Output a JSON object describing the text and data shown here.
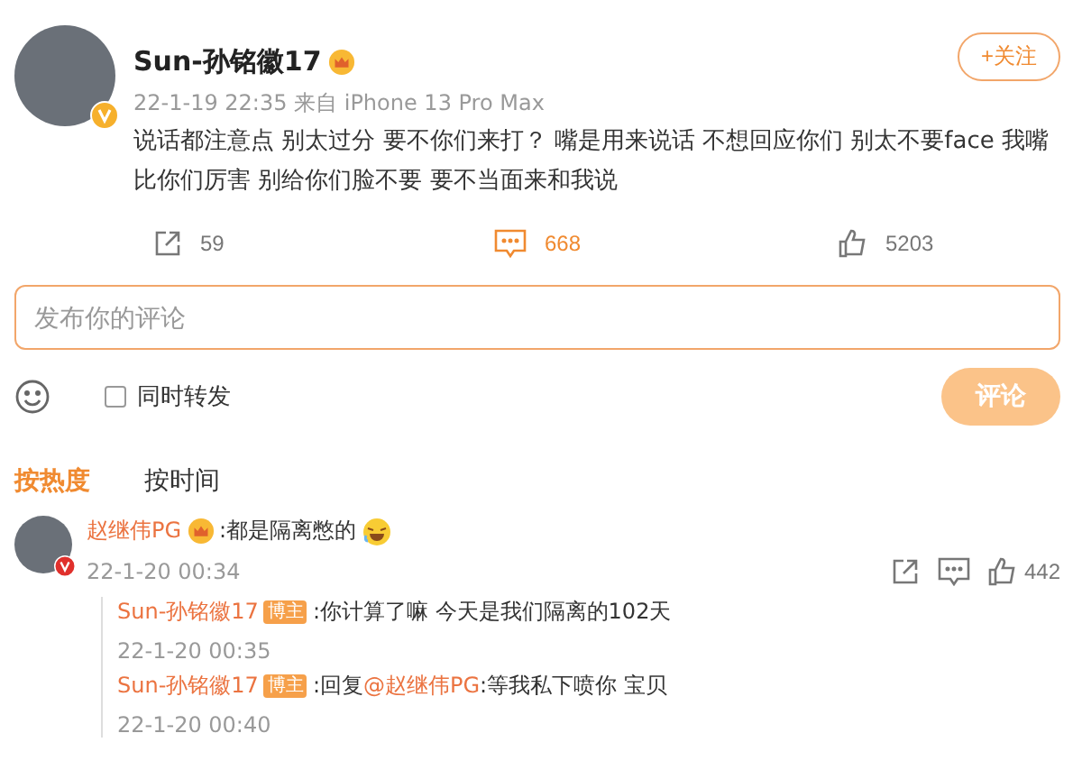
{
  "post": {
    "author": "Sun-孙铭徽17",
    "follow_label": "+关注",
    "meta": "22-1-19 22:35 来自 iPhone 13 Pro Max",
    "text": "说话都注意点 别太过分 要不你们来打？ 嘴是用来说话 不想回应你们 别太不要face 我嘴比你们厉害 别给你们脸不要 要不当面来和我说"
  },
  "actions": [
    {
      "kind": "share",
      "count": "59",
      "selected": false
    },
    {
      "kind": "comment",
      "count": "668",
      "selected": true
    },
    {
      "kind": "like",
      "count": "5203",
      "selected": false
    }
  ],
  "composer": {
    "placeholder": "发布你的评论",
    "repost_label": "同时转发",
    "repost_checked": false,
    "submit_label": "评论"
  },
  "sort_tabs": [
    {
      "label": "按热度",
      "selected": true
    },
    {
      "label": "按时间",
      "selected": false
    }
  ],
  "comment": {
    "author": "赵继伟PG",
    "text": ":都是隔离憋的",
    "time": "22-1-20 00:34",
    "likes": "442",
    "replies": [
      {
        "author": "Sun-孙铭徽17",
        "badge": "博主",
        "text": ":你计算了嘛 今天是我们隔离的102天",
        "time": "22-1-20 00:35"
      },
      {
        "author": "Sun-孙铭徽17",
        "badge": "博主",
        "prefix": ":回复",
        "mention": "@赵继伟PG",
        "text": ":等我私下喷你 宝贝",
        "time": "22-1-20 00:40"
      }
    ]
  }
}
